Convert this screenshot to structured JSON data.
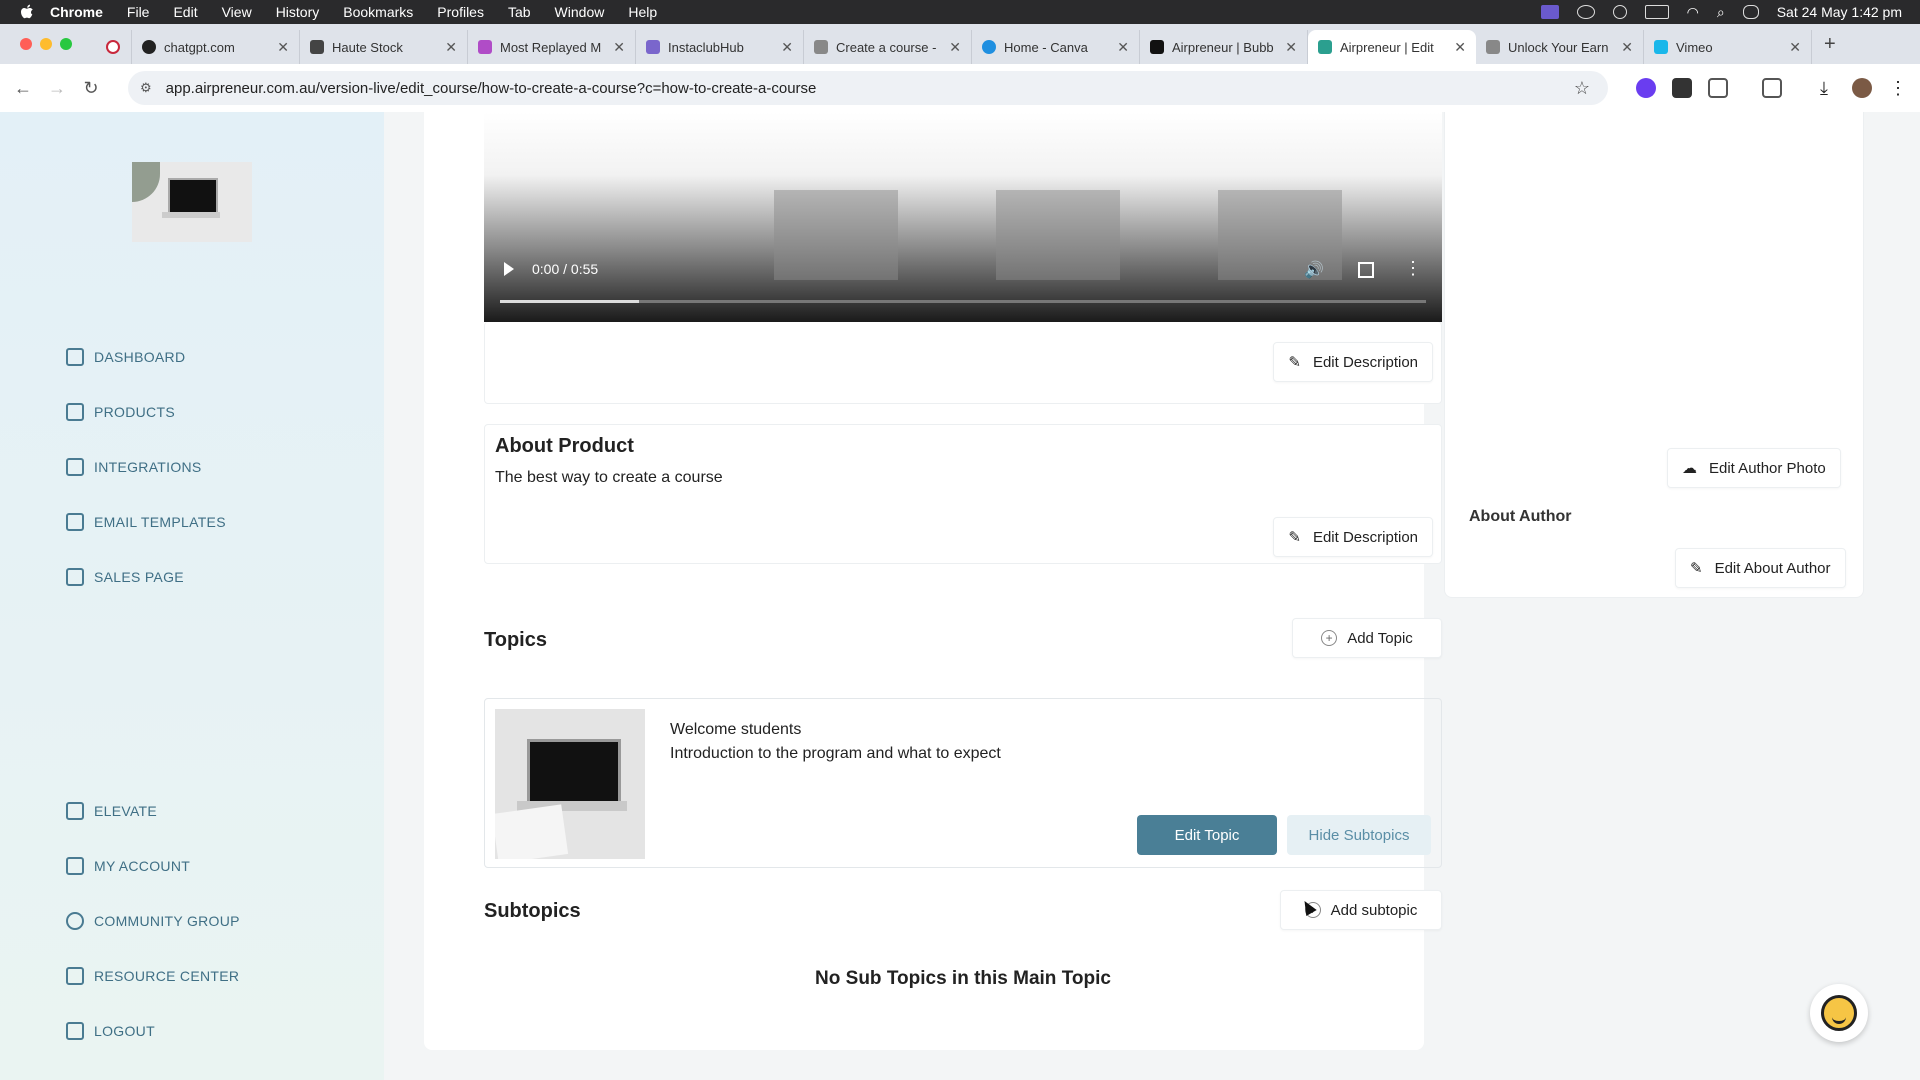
{
  "menubar": {
    "app_name": "Chrome",
    "items": [
      "File",
      "Edit",
      "View",
      "History",
      "Bookmarks",
      "Profiles",
      "Tab",
      "Window",
      "Help"
    ],
    "datetime": "Sat 24 May  1:42 pm"
  },
  "tabs": [
    {
      "label": "chatgpt.com",
      "color": "#222222"
    },
    {
      "label": "Haute Stock",
      "color": "#444444"
    },
    {
      "label": "Most Replayed M",
      "color": "#b04cc7"
    },
    {
      "label": "InstaclubHub",
      "color": "#7a66cc"
    },
    {
      "label": "Create a course -",
      "color": "#888888"
    },
    {
      "label": "Home - Canva",
      "color": "#1f8fe0"
    },
    {
      "label": "Airpreneur | Bubb",
      "color": "#111111"
    },
    {
      "label": "Airpreneur | Edit",
      "color": "#2b9f8f",
      "active": true
    },
    {
      "label": "Unlock Your Earn",
      "color": "#888888"
    },
    {
      "label": "Vimeo",
      "color": "#1ab7ea"
    }
  ],
  "address": {
    "url": "app.airpreneur.com.au/version-live/edit_course/how-to-create-a-course?c=how-to-create-a-course"
  },
  "sidebar": {
    "items_top": [
      {
        "label": "DASHBOARD"
      },
      {
        "label": "PRODUCTS"
      },
      {
        "label": "INTEGRATIONS"
      },
      {
        "label": "EMAIL TEMPLATES"
      },
      {
        "label": "SALES PAGE"
      }
    ],
    "items_bottom": [
      {
        "label": "ELEVATE"
      },
      {
        "label": "MY ACCOUNT"
      },
      {
        "label": "COMMUNITY GROUP"
      },
      {
        "label": "RESOURCE CENTER"
      },
      {
        "label": "LOGOUT"
      }
    ]
  },
  "video": {
    "time": "0:00 / 0:55",
    "progress": 0.15
  },
  "product": {
    "edit_description_label": "Edit Description",
    "about_heading": "About Product",
    "about_text": "The best way to create a course"
  },
  "topics": {
    "heading": "Topics",
    "add_label": "Add Topic",
    "items": [
      {
        "title": "Welcome students",
        "description": "Introduction to the program and what to expect",
        "edit_label": "Edit Topic",
        "hide_label": "Hide Subtopics"
      }
    ]
  },
  "subtopics": {
    "heading": "Subtopics",
    "add_label": "Add subtopic",
    "empty_text": "No Sub Topics in this Main Topic"
  },
  "author": {
    "edit_photo_label": "Edit Author Photo",
    "about_heading": "About Author",
    "edit_about_label": "Edit About Author"
  },
  "colors": {
    "accent": "#4a7f96",
    "sidebar_text": "#3f6f85"
  }
}
